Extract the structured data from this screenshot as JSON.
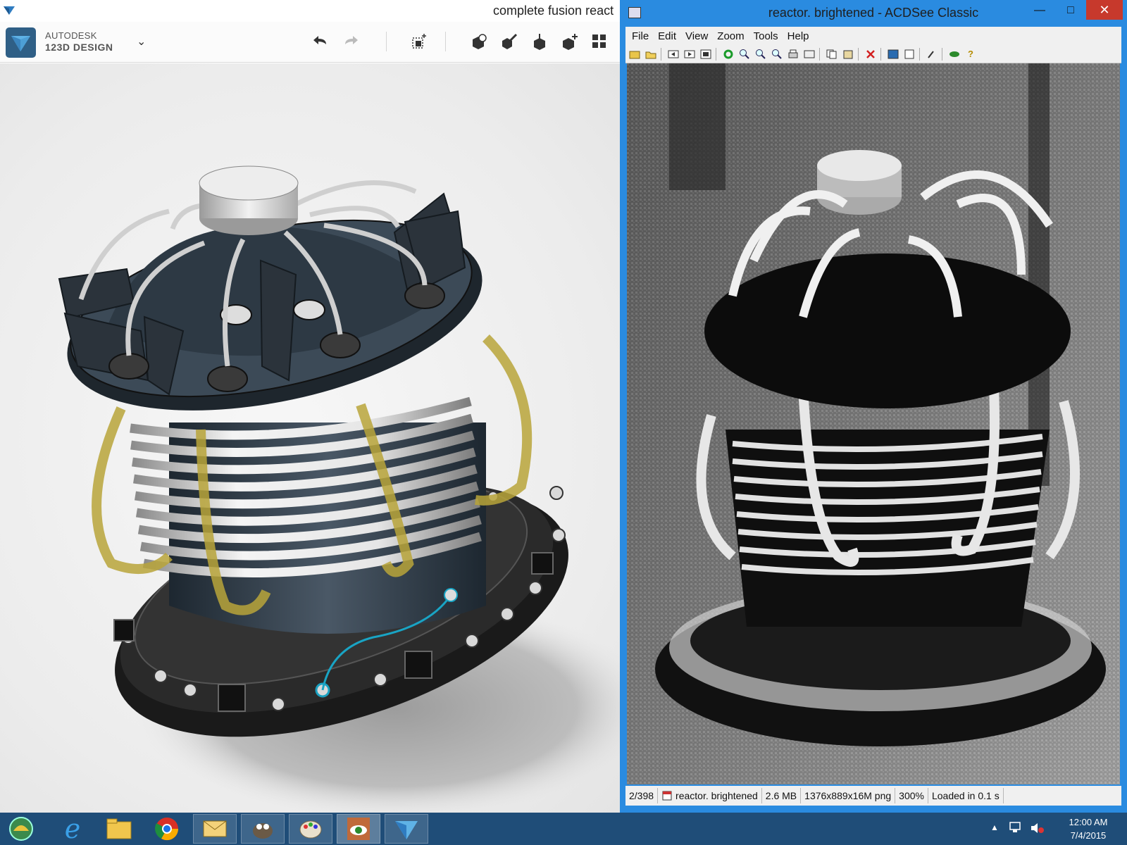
{
  "app123d": {
    "window_title": "complete fusion react",
    "brand_line1": "AUTODESK",
    "brand_line2": "123D DESIGN",
    "toolbar": {
      "undo": "undo-icon",
      "redo": "redo-icon",
      "transform": "transform-icon",
      "primitives": "primitives-icon",
      "sketch": "sketch-icon",
      "construct": "construct-icon",
      "modify": "modify-icon",
      "pattern": "pattern-icon"
    },
    "accent": "#2f5f86"
  },
  "acdsee": {
    "window_title": "reactor. brightened - ACDSee Classic",
    "menu": [
      "File",
      "Edit",
      "View",
      "Zoom",
      "Tools",
      "Help"
    ],
    "status": {
      "index": "2/398",
      "filename": "reactor. brightened",
      "size": "2.6 MB",
      "dims": "1376x889x16M png",
      "zoom": "300%",
      "load": "Loaded in 0.1 s"
    },
    "title_color": "#2a8be0"
  },
  "taskbar": {
    "apps": [
      "shell-icon",
      "internet-explorer-icon",
      "file-explorer-icon",
      "chrome-icon",
      "mail-icon",
      "gimp-icon",
      "paint-icon",
      "acdsee-icon",
      "123d-design-icon"
    ],
    "time": "12:00 AM",
    "date": "7/4/2015"
  }
}
